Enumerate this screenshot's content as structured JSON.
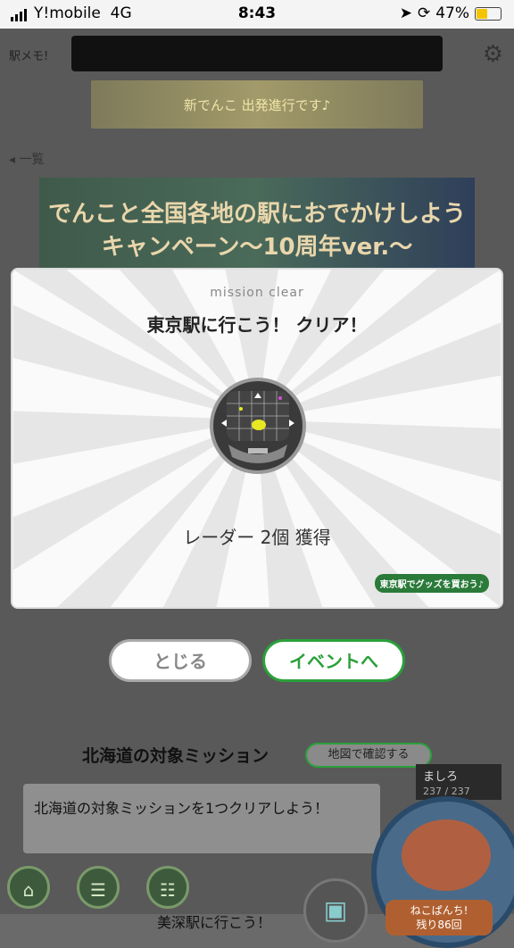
{
  "status": {
    "carrier": "Y!mobile",
    "network": "4G",
    "time": "8:43",
    "battery_pct": "47%",
    "battery_level": 0.47
  },
  "header": {
    "app_label": "駅メモ!",
    "banner_text": "新でんこ 出発進行です♪"
  },
  "nav_back": {
    "label": "一覧"
  },
  "campaign": {
    "title": "でんこと全国各地の駅におでかけしようキャンペーン〜10周年ver.〜"
  },
  "modal": {
    "subtitle": "mission clear",
    "title": "東京駅に行こう！ クリア！",
    "reward_icon": "radar-icon",
    "reward_text": "レーダー 2個 獲得",
    "promo_tag": "東京駅でグッズを買おう♪"
  },
  "buttons": {
    "close_label": "とじる",
    "event_label": "イベントへ"
  },
  "mission_section": {
    "header": "北海道の対象ミッション",
    "map_button": "地図で確認する",
    "description": "北海道の対象ミッションを1つクリアしよう！",
    "mission_name": "美深駅に行こう！"
  },
  "character": {
    "name": "ましろ",
    "hp": "237 / 237",
    "punch_line1": "ねこぱんち!",
    "punch_line2": "残り86回"
  },
  "colors": {
    "accent": "#2aa03a",
    "overlay": "#595959",
    "modal": "#fafafa"
  }
}
